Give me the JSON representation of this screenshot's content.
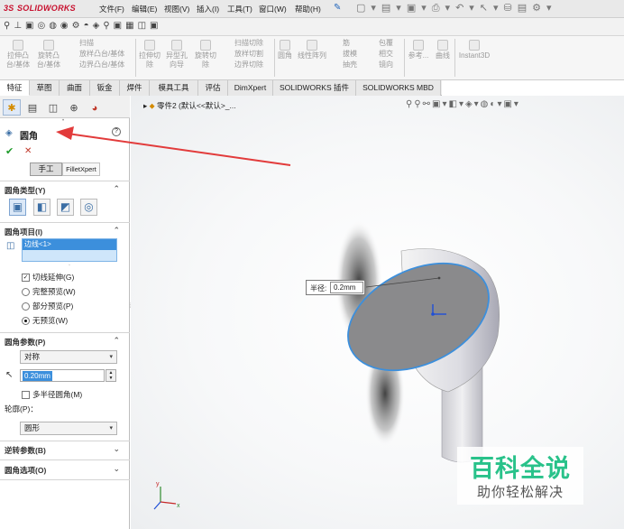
{
  "app": {
    "logo_text": "SOLIDWORKS",
    "logo_prefix": "3S"
  },
  "menu": {
    "items": [
      "文件(F)",
      "编辑(E)",
      "视图(V)",
      "插入(I)",
      "工具(T)",
      "窗口(W)",
      "帮助(H)"
    ],
    "pin_icon": "pin-icon"
  },
  "ribbon": {
    "groups": [
      {
        "labels": [
          "拉伸凸台/基体",
          "旋转凸台/基体"
        ]
      },
      {
        "labels": [
          "扫描",
          "放样凸台/基体",
          "边界凸台/基体"
        ]
      },
      {
        "labels": [
          "拉伸切除",
          "异型孔向导",
          "旋转切除"
        ]
      },
      {
        "labels": [
          "扫描切除",
          "放样切割",
          "边界切除"
        ]
      },
      {
        "labels": [
          "圆角",
          "线性阵列"
        ]
      },
      {
        "labels": [
          "筋",
          "拔模",
          "抽壳"
        ]
      },
      {
        "labels": [
          "包覆",
          "相交",
          "镜向"
        ]
      },
      {
        "labels": [
          "参考...",
          "曲线"
        ]
      },
      {
        "labels": [
          "Instant3D"
        ]
      }
    ]
  },
  "tabs": [
    "特征",
    "草图",
    "曲面",
    "钣金",
    "焊件",
    "模具工具",
    "评估",
    "DimXpert",
    "SOLIDWORKS 插件",
    "SOLIDWORKS MBD"
  ],
  "panel": {
    "title": "圆角",
    "help_icon": "help-icon",
    "ok_icon": "check-icon",
    "cancel_icon": "close-icon",
    "mode_manual": "手工",
    "mode_filletxpert": "FilletXpert",
    "fillet_type_title": "圆角类型(Y)",
    "fillet_items_title": "圆角项目(I)",
    "edge_value": "边线<1>",
    "tangent_propagation": "切线延伸(G)",
    "preview_full": "完整预览(W)",
    "preview_partial": "部分预览(P)",
    "preview_none": "无预览(W)",
    "fillet_params_title": "圆角参数(P)",
    "symmetric": "对称",
    "radius_value": "0.20mm",
    "multi_radius": "多半径圆角(M)",
    "profile_label": "轮廓(P)：",
    "profile_value": "圆形",
    "reverse_params_title": "逆转参数(B)",
    "fillet_options_title": "圆角选项(O)"
  },
  "viewport": {
    "breadcrumb": "零件2 (默认<<默认>_...",
    "radius_label": "半径:",
    "radius_value": "0.2mm"
  },
  "watermark": {
    "line1": "百科全说",
    "line2": "助你轻松解决"
  },
  "colors": {
    "accent_red": "#c8102e",
    "selection_blue": "#3c8fdc",
    "watermark_green": "#29c28a",
    "annotation_arrow": "#e23b3b"
  }
}
